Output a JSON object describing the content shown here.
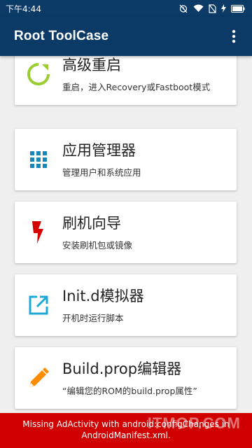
{
  "status_bar": {
    "time": "下午4:44",
    "icons": [
      "alarm-off-icon",
      "wifi-icon",
      "sim-off-icon",
      "charging-icon",
      "battery-icon"
    ]
  },
  "app_bar": {
    "title": "Root ToolCase",
    "menu_icon": "more-vert-icon"
  },
  "cards": [
    {
      "title": "高级重启",
      "subtitle": "重启，进入Recovery或Fastboot模式",
      "icon": "reboot-icon",
      "icon_color": "#9acd32"
    },
    {
      "title": "应用管理器",
      "subtitle": "管理用户和系统应用",
      "icon": "apps-grid-icon",
      "icon_color": "#1a86b8"
    },
    {
      "title": "刷机向导",
      "subtitle": "安装刷机包或镜像",
      "icon": "flash-icon",
      "icon_color": "#d50000"
    },
    {
      "title": "Init.d模拟器",
      "subtitle": "开机时运行脚本",
      "icon": "open-in-new-icon",
      "icon_color": "#1ba9d6"
    },
    {
      "title": "Build.prop编辑器",
      "subtitle": "“编辑您的ROM的build.prop属性”",
      "icon": "edit-pencil-icon",
      "icon_color": "#ff8c00"
    }
  ],
  "error_banner": {
    "text": "Missing AdActivity with android:configChanges in AndroidManifest.xml."
  },
  "watermark": "ITMOP.COM",
  "colors": {
    "app_bar": "#0b3a67",
    "background": "#efefef",
    "error": "#d10000"
  }
}
